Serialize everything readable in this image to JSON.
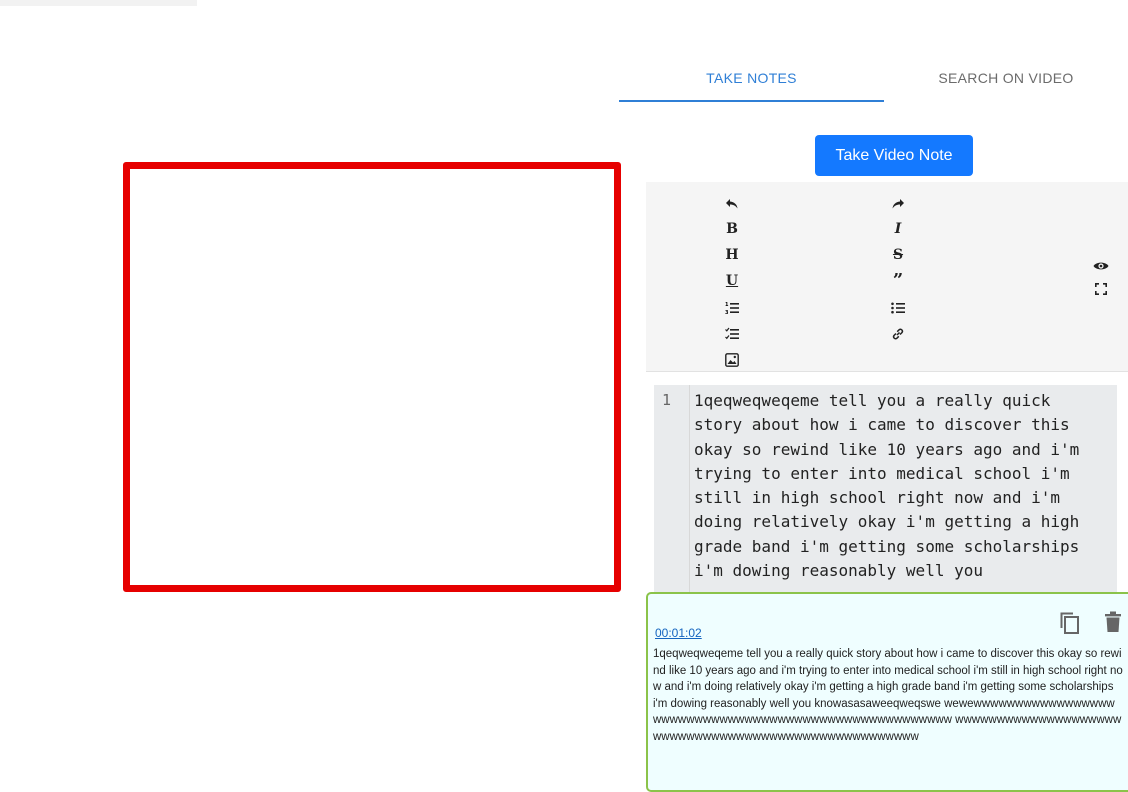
{
  "tabs": [
    {
      "label": "TAKE NOTES",
      "active": true
    },
    {
      "label": "SEARCH ON VIDEO",
      "active": false
    }
  ],
  "take_note_button": "Take Video Note",
  "toolbar": {
    "left_column": [
      "undo-icon",
      "bold-icon",
      "heading-icon",
      "underline-icon",
      "ordered-list-icon",
      "checklist-icon",
      "image-icon"
    ],
    "right_column": [
      "redo-icon",
      "italic-icon",
      "strikethrough-icon",
      "quote-icon",
      "unordered-list-icon",
      "link-icon"
    ],
    "far_right": [
      "preview-eye-icon",
      "fullscreen-icon"
    ]
  },
  "editor": {
    "line_number": "1",
    "text": "1qeqweqweqeme tell you a really quick story about how i came to discover this okay so rewind like 10 years ago and i'm trying to enter into medical school i'm still in high school right now and i'm doing relatively okay i'm getting a high grade band i'm getting some scholarships i'm dowing reasonably well you"
  },
  "note": {
    "timestamp": "00:01:02",
    "text": "1qeqweqweqeme tell you a really quick story about how i came to discover this okay so rewind like 10 years ago and i'm trying to enter into medical school i'm still in high school right now and i'm doing relatively okay i'm getting a high grade band i'm getting some scholarships i'm dowing reasonably well you knowasasaweeqweqswe wewewwwwwwwwwwwwwwwww wwwwwwwwwwwwwwwwwwwwwwwwwwwwwwwwwwww wwwwwwwwwwwwwwwwwwwwwwwwwwwwwwwwwwwwwwwwwwwwwwwwwwww"
  },
  "colors": {
    "accent": "#2f7fd6",
    "button": "#1479ff",
    "video_border": "#e60000",
    "note_border": "#8bc34a",
    "note_bg": "#effeff"
  }
}
